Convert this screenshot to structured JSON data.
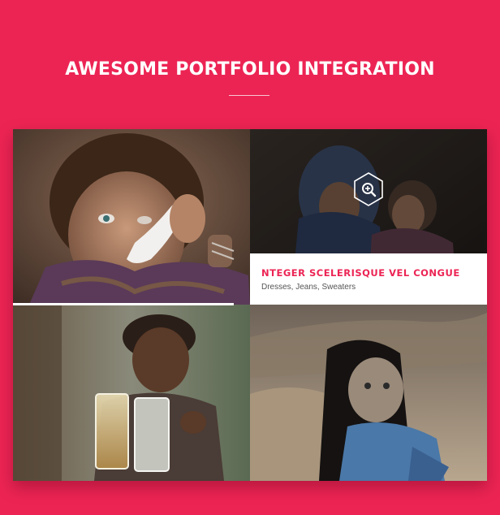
{
  "section": {
    "title": "AWESOME PORTFOLIO INTEGRATION"
  },
  "portfolio": {
    "items": [
      {
        "image": "girl-with-spoon-photo"
      },
      {
        "image": "mother-and-child-photo",
        "hover": {
          "title": "NTEGER SCELERISQUE VEL CONGUE",
          "tags": "Dresses, Jeans, Sweaters",
          "icon": "zoom-in-icon"
        }
      },
      {
        "image": "girl-with-water-glasses-photo"
      },
      {
        "image": "toddler-in-arms-photo"
      }
    ]
  },
  "colors": {
    "background": "#ec2454",
    "accent": "#ec2454",
    "text_light": "#ffffff"
  }
}
